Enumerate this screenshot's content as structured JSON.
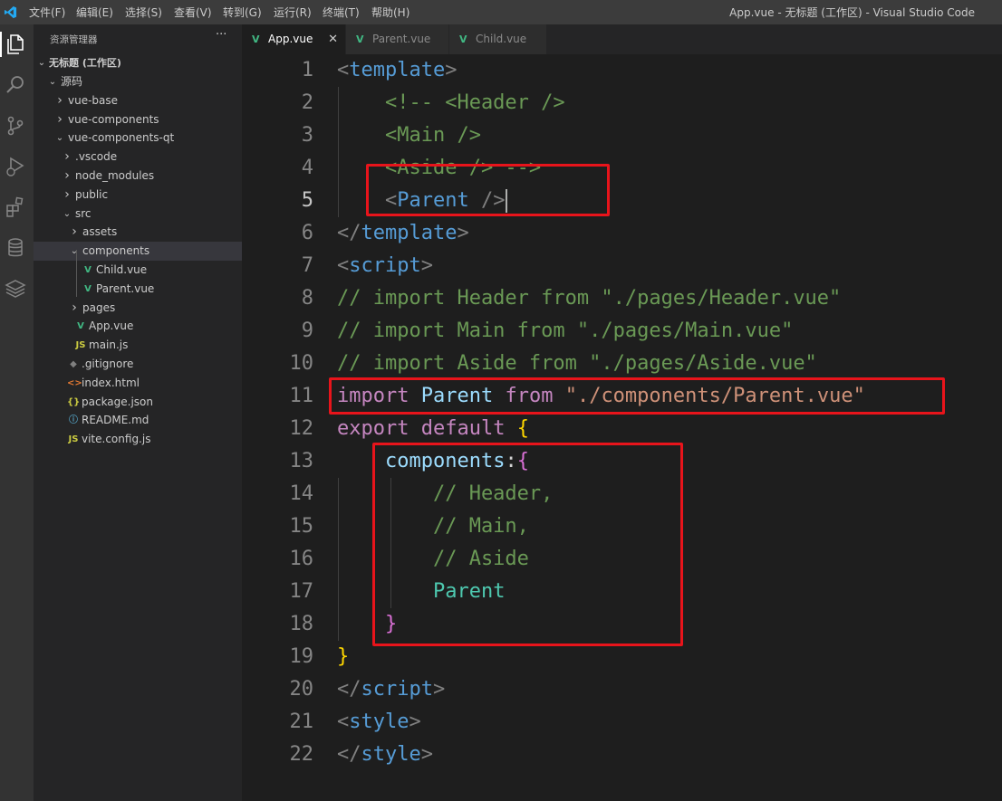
{
  "titlebar": {
    "menus": [
      "文件(F)",
      "编辑(E)",
      "选择(S)",
      "查看(V)",
      "转到(G)",
      "运行(R)",
      "终端(T)",
      "帮助(H)"
    ],
    "window_title": "App.vue - 无标题 (工作区) - Visual Studio Code"
  },
  "activity_icons": [
    "explorer-icon",
    "search-icon",
    "source-control-icon",
    "run-debug-icon",
    "extensions-icon",
    "database-icon",
    "layers-icon"
  ],
  "sidebar": {
    "title": "资源管理器",
    "more": "···",
    "workspace": "无标题 (工作区)",
    "tree": [
      {
        "label": "源码",
        "depth": 1,
        "type": "folder",
        "open": true
      },
      {
        "label": "vue-base",
        "depth": 2,
        "type": "folder",
        "open": false
      },
      {
        "label": "vue-components",
        "depth": 2,
        "type": "folder",
        "open": false
      },
      {
        "label": "vue-components-qt",
        "depth": 2,
        "type": "folder",
        "open": true
      },
      {
        "label": ".vscode",
        "depth": 3,
        "type": "folder",
        "open": false
      },
      {
        "label": "node_modules",
        "depth": 3,
        "type": "folder",
        "open": false
      },
      {
        "label": "public",
        "depth": 3,
        "type": "folder",
        "open": false
      },
      {
        "label": "src",
        "depth": 3,
        "type": "folder",
        "open": true
      },
      {
        "label": "assets",
        "depth": 4,
        "type": "folder",
        "open": false
      },
      {
        "label": "components",
        "depth": 4,
        "type": "folder",
        "open": true,
        "selected": true
      },
      {
        "label": "Child.vue",
        "depth": 5,
        "type": "vue"
      },
      {
        "label": "Parent.vue",
        "depth": 5,
        "type": "vue"
      },
      {
        "label": "pages",
        "depth": 4,
        "type": "folder",
        "open": false
      },
      {
        "label": "App.vue",
        "depth": 4,
        "type": "vue"
      },
      {
        "label": "main.js",
        "depth": 4,
        "type": "js"
      },
      {
        "label": ".gitignore",
        "depth": 3,
        "type": "git"
      },
      {
        "label": "index.html",
        "depth": 3,
        "type": "html"
      },
      {
        "label": "package.json",
        "depth": 3,
        "type": "json"
      },
      {
        "label": "README.md",
        "depth": 3,
        "type": "info"
      },
      {
        "label": "vite.config.js",
        "depth": 3,
        "type": "js"
      }
    ]
  },
  "tabs": [
    {
      "label": "App.vue",
      "active": true,
      "close": "✕"
    },
    {
      "label": "Parent.vue",
      "active": false
    },
    {
      "label": "Child.vue",
      "active": false
    }
  ],
  "editor": {
    "current_line": 5,
    "lines": [
      [
        [
          "<",
          "punc"
        ],
        [
          "template",
          "tag"
        ],
        [
          ">",
          "punc"
        ]
      ],
      [
        [
          "    <!-- <Header />",
          "cmt"
        ]
      ],
      [
        [
          "    <Main />",
          "cmt"
        ]
      ],
      [
        [
          "    <Aside /> -->",
          "cmt"
        ]
      ],
      [
        [
          "    ",
          "plain"
        ],
        [
          "<",
          "punc"
        ],
        [
          "Parent",
          "tag"
        ],
        [
          " />",
          "punc"
        ]
      ],
      [
        [
          "</",
          "punc"
        ],
        [
          "template",
          "tag"
        ],
        [
          ">",
          "punc"
        ]
      ],
      [
        [
          "<",
          "punc"
        ],
        [
          "script",
          "tag"
        ],
        [
          ">",
          "punc"
        ]
      ],
      [
        [
          "// import Header from \"./pages/Header.vue\"",
          "cmt"
        ]
      ],
      [
        [
          "// import Main from \"./pages/Main.vue\"",
          "cmt"
        ]
      ],
      [
        [
          "// import Aside from \"./pages/Aside.vue\"",
          "cmt"
        ]
      ],
      [
        [
          "import",
          "kw"
        ],
        [
          " ",
          "plain"
        ],
        [
          "Parent",
          "var"
        ],
        [
          " ",
          "plain"
        ],
        [
          "from",
          "kw"
        ],
        [
          " ",
          "plain"
        ],
        [
          "\"./components/Parent.vue\"",
          "str"
        ]
      ],
      [
        [
          "export",
          "kw"
        ],
        [
          " ",
          "plain"
        ],
        [
          "default",
          "kw"
        ],
        [
          " ",
          "plain"
        ],
        [
          "{",
          "b1"
        ]
      ],
      [
        [
          "    ",
          "plain"
        ],
        [
          "components",
          "prop"
        ],
        [
          ":",
          "plain"
        ],
        [
          "{",
          "b2"
        ]
      ],
      [
        [
          "        // Header,",
          "cmt"
        ]
      ],
      [
        [
          "        // Main,",
          "cmt"
        ]
      ],
      [
        [
          "        // Aside",
          "cmt"
        ]
      ],
      [
        [
          "        ",
          "plain"
        ],
        [
          "Parent",
          "teal"
        ]
      ],
      [
        [
          "    ",
          "plain"
        ],
        [
          "}",
          "b2"
        ]
      ],
      [
        [
          "}",
          "b1"
        ]
      ],
      [
        [
          "</",
          "punc"
        ],
        [
          "script",
          "tag"
        ],
        [
          ">",
          "punc"
        ]
      ],
      [
        [
          "<",
          "punc"
        ],
        [
          "style",
          "tag"
        ],
        [
          ">",
          "punc"
        ]
      ],
      [
        [
          "</",
          "punc"
        ],
        [
          "style",
          "tag"
        ],
        [
          ">",
          "punc"
        ]
      ]
    ]
  },
  "colors": {
    "highlight_box": "#e8141b",
    "vue_icon": "#41b883",
    "js_icon": "#cbcb41"
  }
}
